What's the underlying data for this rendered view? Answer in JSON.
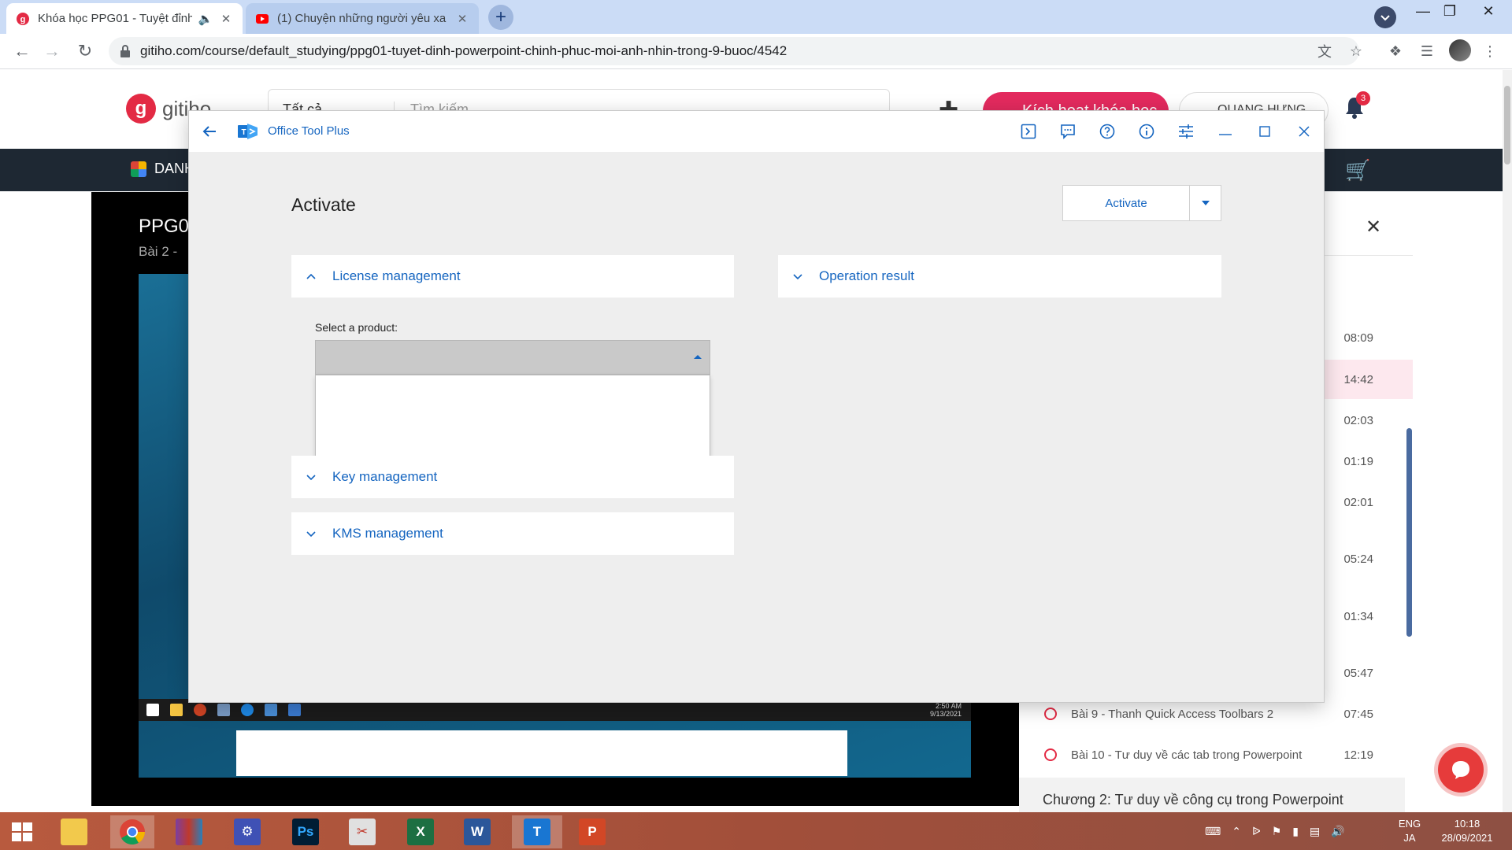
{
  "browser": {
    "tabs": [
      {
        "title": "Khóa học PPG01 - Tuyệt đỉnh",
        "active": true
      },
      {
        "title": "(1) Chuyện những người yêu xa /",
        "active": false
      }
    ],
    "new_tab_label": "+",
    "url": "gitiho.com/course/default_studying/ppg01-tuyet-dinh-powerpoint-chinh-phuc-moi-anh-nhin-trong-9-buoc/4542"
  },
  "site": {
    "logo_text": "gitiho",
    "search_category": "Tất cả",
    "search_placeholder": "Tìm kiếm",
    "activate_course_label": "Kích hoạt khóa học",
    "user_name": "QUANG HƯNG",
    "notification_count": "3",
    "menu_label": "DANH",
    "video_title": "PPG0",
    "video_subtitle": "Bài 2 - ",
    "video_clock": {
      "time": "2:50 AM",
      "date": "9/13/2021"
    }
  },
  "sidebar": {
    "lessons": [
      {
        "label": "",
        "duration": "08:09",
        "highlight": false
      },
      {
        "label": "",
        "duration": "14:42",
        "highlight": true
      },
      {
        "label": "",
        "duration": "02:03",
        "highlight": false
      },
      {
        "label": "",
        "duration": "01:19",
        "highlight": false
      },
      {
        "label": "",
        "duration": "02:01",
        "highlight": false
      },
      {
        "label": "",
        "duration": "05:24",
        "highlight": false
      },
      {
        "label": "",
        "duration": "01:34",
        "highlight": false
      },
      {
        "label": "",
        "duration": "05:47",
        "highlight": false
      },
      {
        "label": "Bài 9 - Thanh Quick Access Toolbars 2",
        "duration": "07:45",
        "highlight": false
      },
      {
        "label": "Bài 10 - Tư duy về các tab trong Powerpoint",
        "duration": "12:19",
        "highlight": false
      }
    ],
    "chapter": "Chương 2: Tư duy về công cụ trong Powerpoint"
  },
  "otp": {
    "window_title": "Office Tool Plus",
    "page_title": "Activate",
    "activate_button": "Activate",
    "license_panel": {
      "title": "License management",
      "select_label": "Select a product:",
      "selected_value": ""
    },
    "key_panel_title": "Key management",
    "kms_panel_title": "KMS management",
    "result_panel_title": "Operation result"
  },
  "taskbar": {
    "language_top": "ENG",
    "language_bottom": "JA",
    "time": "10:18",
    "date": "28/09/2021"
  },
  "colors": {
    "otp_accent": "#1565c0",
    "gitiho_red": "#e32a44",
    "chrome_tabstrip": "#cbdcf6"
  }
}
